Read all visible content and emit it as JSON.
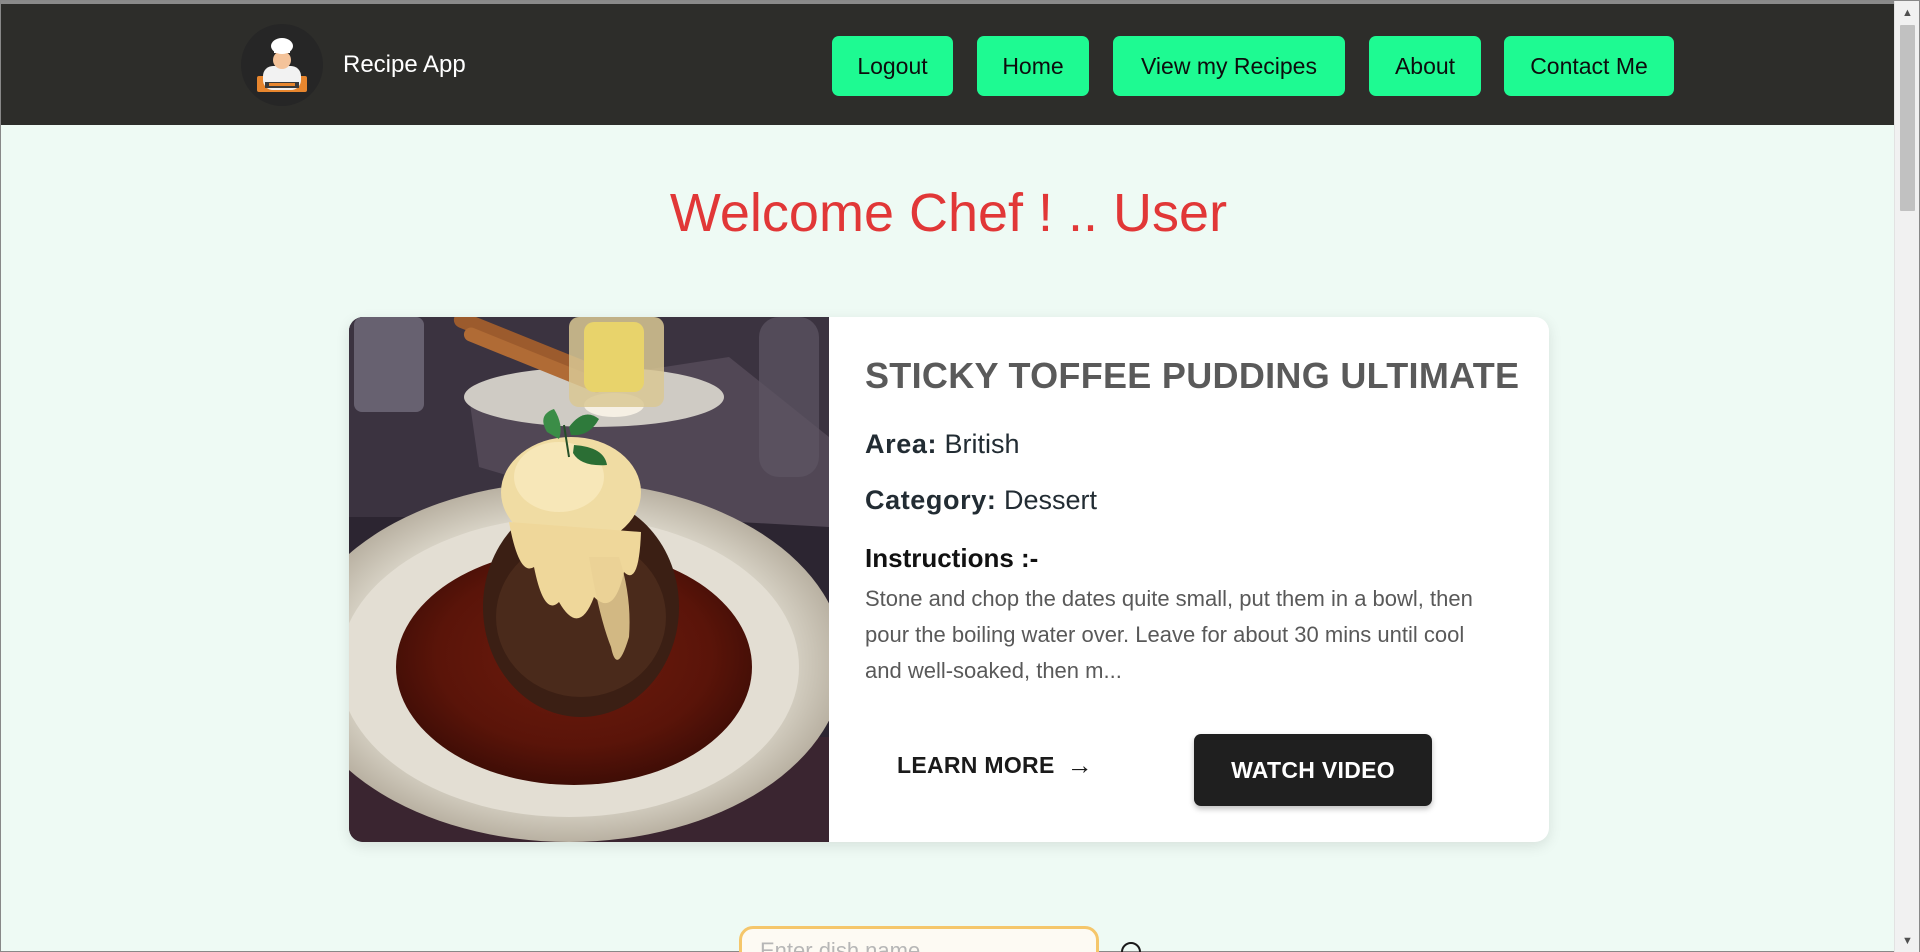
{
  "brand": {
    "name": "Recipe App",
    "logo_icon": "chef-master-logo-icon"
  },
  "nav": {
    "logout": "Logout",
    "home": "Home",
    "view_recipes": "View my Recipes",
    "about": "About",
    "contact": "Contact Me"
  },
  "welcome": "Welcome Chef ! .. User",
  "recipe": {
    "title": "STICKY TOFFEE PUDDING ULTIMATE",
    "area_label": "Area:",
    "area": "British",
    "category_label": "Category:",
    "category": "Dessert",
    "instructions_heading": "Instructions :-",
    "instructions": "Stone and chop the dates quite small, put them in a bowl, then pour the boiling water over. Leave for about 30 mins until cool and well-soaked, then m...",
    "learn_more": "LEARN MORE",
    "watch_video": "WATCH VIDEO"
  },
  "search": {
    "placeholder": "Enter dish name"
  },
  "colors": {
    "navbar_bg": "#2d2d2a",
    "nav_button": "#1efa92",
    "welcome": "#e13737",
    "page_bg": "#eefaf4",
    "watch_video_bg": "#1f1f1f",
    "search_border": "#f5c66b"
  }
}
